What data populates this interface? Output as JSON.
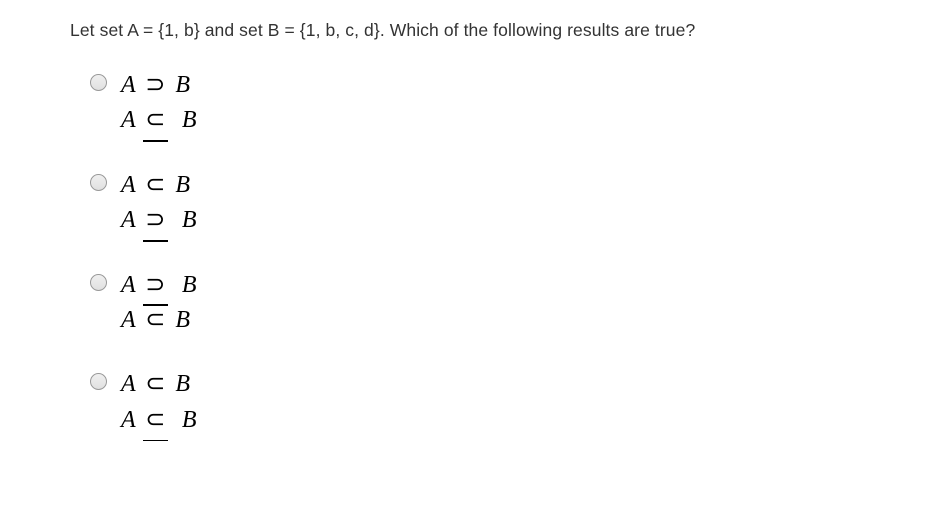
{
  "question": "Let set A = {1, b} and set B = {1, b, c, d}. Which of the following results are true?",
  "options": [
    {
      "line1": {
        "left": "A",
        "rel": "⊃",
        "right": "B",
        "negated_rel": false,
        "subset_bar": false
      },
      "line2": {
        "left": "A",
        "rel": "⊂",
        "right": "B",
        "negated_rel": true,
        "subset_bar": true
      }
    },
    {
      "line1": {
        "left": "A",
        "rel": "⊂",
        "right": "B",
        "negated_rel": false,
        "subset_bar": false
      },
      "line2": {
        "left": "A",
        "rel": "⊃",
        "right": "B",
        "negated_rel": true,
        "subset_bar": false
      }
    },
    {
      "line1": {
        "left": "A",
        "rel": "⊃",
        "right": "B",
        "negated_rel": true,
        "subset_bar": false
      },
      "line2": {
        "left": "A",
        "rel": "⊂",
        "right": "B",
        "negated_rel": false,
        "subset_bar": false
      }
    },
    {
      "line1": {
        "left": "A",
        "rel": "⊂",
        "right": "B",
        "negated_rel": false,
        "subset_bar": false
      },
      "line2": {
        "left": "A",
        "rel": "⊂",
        "right": "B",
        "negated_rel": true,
        "subset_bar": true
      }
    }
  ]
}
